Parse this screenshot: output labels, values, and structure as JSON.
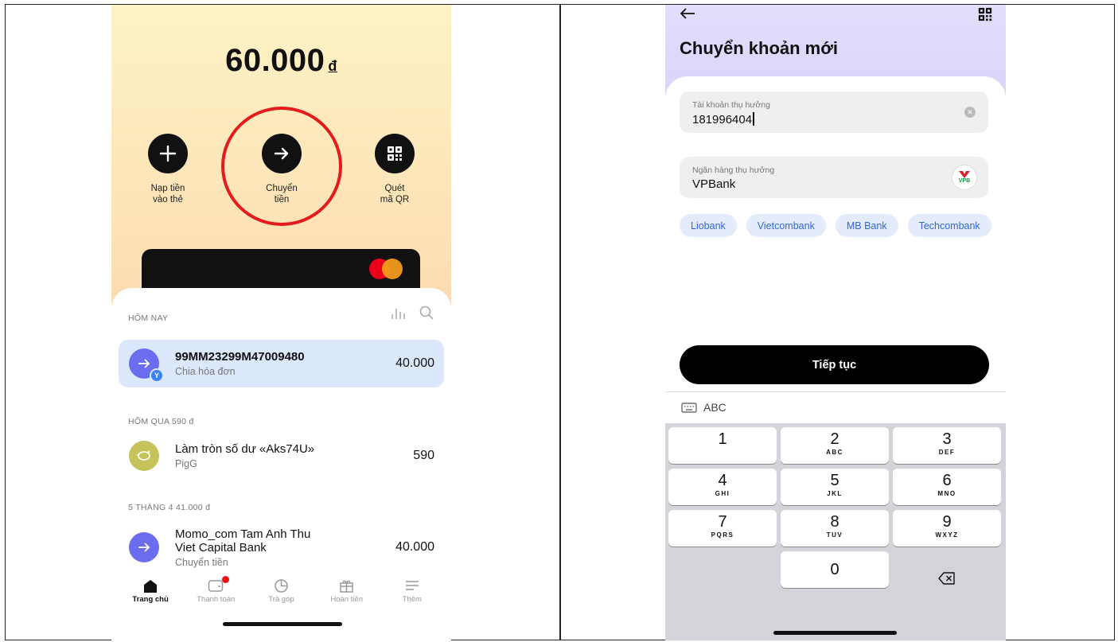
{
  "left": {
    "balance": "60.000",
    "currency": "đ",
    "actions": [
      {
        "label": "Nạp tiền\nvào thẻ",
        "icon": "plus-icon"
      },
      {
        "label": "Chuyển\ntiền",
        "icon": "arrow-right-icon"
      },
      {
        "label": "Quét\nmã QR",
        "icon": "qr-code-icon"
      }
    ],
    "sections": {
      "today": "HÔM NAY",
      "yesterday": "HÔM QUA 590 đ",
      "apr5": "5 THÁNG 4 41.000 đ"
    },
    "transactions": [
      {
        "title": "99MM23299M47009480",
        "subtitle": "Chia hóa đơn",
        "amount": "40.000"
      },
      {
        "title": "Làm tròn số dư «Aks74U»",
        "subtitle": "PigG",
        "amount": "590"
      },
      {
        "title": "Momo_com Tam Anh Thu\nViet Capital Bank",
        "subtitle": "Chuyển tiền",
        "amount": "40.000"
      }
    ],
    "nav": [
      "Trang chủ",
      "Thanh toán",
      "Trả góp",
      "Hoàn tiền",
      "Thêm"
    ]
  },
  "right": {
    "title": "Chuyển khoản mới",
    "account_label": "Tài khoản thụ hưởng",
    "account_value": "181996404",
    "bank_label": "Ngân hàng thụ hưởng",
    "bank_value": "VPBank",
    "bank_logo_text": "VPB",
    "chips": [
      "Liobank",
      "Vietcombank",
      "MB Bank",
      "Techcombank"
    ],
    "continue": "Tiếp tục",
    "kb_mode": "ABC",
    "keys": [
      {
        "d": "1",
        "s": ""
      },
      {
        "d": "2",
        "s": "ABC"
      },
      {
        "d": "3",
        "s": "DEF"
      },
      {
        "d": "4",
        "s": "GHI"
      },
      {
        "d": "5",
        "s": "JKL"
      },
      {
        "d": "6",
        "s": "MNO"
      },
      {
        "d": "7",
        "s": "PQRS"
      },
      {
        "d": "8",
        "s": "TUV"
      },
      {
        "d": "9",
        "s": "WXYZ"
      },
      {
        "d": "0",
        "s": ""
      }
    ],
    "colors": {
      "chip_bg": "#e4ecfb",
      "chip_text": "#3468d0",
      "highlight": "#dbe8fb",
      "ring": "#e41b1b"
    }
  }
}
